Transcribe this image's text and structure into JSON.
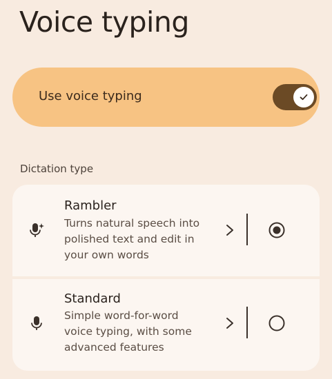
{
  "page": {
    "title": "Voice typing"
  },
  "voice_toggle": {
    "label": "Use voice typing",
    "enabled": true
  },
  "dictation": {
    "section_label": "Dictation type",
    "options": [
      {
        "title": "Rambler",
        "description_lines": [
          "Turns natural speech into",
          "polished text and edit in",
          "your own words"
        ],
        "icon": "mic-sparkle-icon",
        "selected": true
      },
      {
        "title": "Standard",
        "description_lines": [
          "Simple word-for-word",
          "voice typing, with some",
          "advanced features"
        ],
        "icon": "mic-icon",
        "selected": false
      }
    ]
  },
  "colors": {
    "background": "#f8ebe0",
    "toggle_card": "#f7c383",
    "switch_track": "#6b4a25",
    "options_card": "#fcf6f1"
  }
}
